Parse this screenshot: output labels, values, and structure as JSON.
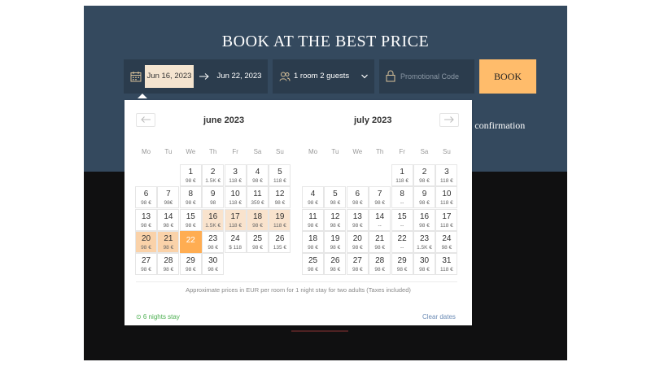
{
  "header": {
    "title": "BOOK AT THE BEST PRICE",
    "confirmation_fragment": "e confirmation"
  },
  "search": {
    "check_in": "Jun 16, 2023",
    "check_out": "Jun 22, 2023",
    "guests": "1 room 2 guests",
    "promo_placeholder": "Promotional Code",
    "book_label": "BOOK"
  },
  "colors": {
    "hero_bg": "#34495e",
    "field_bg": "#2b3c4d",
    "book_button": "#ffbc6b",
    "selected_end": "#ffad52",
    "range_bg": "#f9e3cd",
    "stay_text": "#4caf50",
    "link": "#6b8bb5"
  },
  "icons": [
    "calendar-icon",
    "arrow-right-icon",
    "people-icon",
    "chevron-down-icon",
    "lock-icon",
    "arrow-left-icon"
  ],
  "calendar": {
    "weekdays": [
      "Mo",
      "Tu",
      "We",
      "Th",
      "Fr",
      "Sa",
      "Su"
    ],
    "months": [
      {
        "name": "june 2023",
        "first_weekday": 3,
        "days": [
          {
            "d": "1",
            "p": "98 €"
          },
          {
            "d": "2",
            "p": "1.5K €"
          },
          {
            "d": "3",
            "p": "118 €"
          },
          {
            "d": "4",
            "p": "98 €"
          },
          {
            "d": "5",
            "p": "118 €"
          },
          {
            "d": "6",
            "p": "98 €"
          },
          {
            "d": "7",
            "p": "98€"
          },
          {
            "d": "8",
            "p": "98 €"
          },
          {
            "d": "9",
            "p": "98"
          },
          {
            "d": "10",
            "p": "118 €"
          },
          {
            "d": "11",
            "p": "359 €"
          },
          {
            "d": "12",
            "p": "98 €"
          },
          {
            "d": "13",
            "p": "98 €"
          },
          {
            "d": "14",
            "p": "98 €"
          },
          {
            "d": "15",
            "p": "98 €"
          },
          {
            "d": "16",
            "p": "1.5K €",
            "state": "range"
          },
          {
            "d": "17",
            "p": "118 €",
            "state": "range"
          },
          {
            "d": "18",
            "p": "98 €",
            "state": "range"
          },
          {
            "d": "19",
            "p": "118 €",
            "state": "range"
          },
          {
            "d": "20",
            "p": "98 €",
            "state": "sel"
          },
          {
            "d": "21",
            "p": "98 €",
            "state": "sel"
          },
          {
            "d": "22",
            "p": "",
            "state": "end"
          },
          {
            "d": "23",
            "p": "98 €"
          },
          {
            "d": "24",
            "p": "$ 118"
          },
          {
            "d": "25",
            "p": "98 €"
          },
          {
            "d": "26",
            "p": "135 €"
          },
          {
            "d": "27",
            "p": "98 €"
          },
          {
            "d": "28",
            "p": "98 €"
          },
          {
            "d": "29",
            "p": "98 €"
          },
          {
            "d": "30",
            "p": "98 €"
          }
        ]
      },
      {
        "name": "july 2023",
        "first_weekday": 5,
        "days": [
          {
            "d": "1",
            "p": "118 €"
          },
          {
            "d": "2",
            "p": "98 €"
          },
          {
            "d": "3",
            "p": "118 €"
          },
          {
            "d": "4",
            "p": "98 €"
          },
          {
            "d": "5",
            "p": "98 €"
          },
          {
            "d": "6",
            "p": "98 €"
          },
          {
            "d": "7",
            "p": "98 €"
          },
          {
            "d": "8",
            "p": "--"
          },
          {
            "d": "9",
            "p": "98 €"
          },
          {
            "d": "10",
            "p": "118 €"
          },
          {
            "d": "11",
            "p": "98 €"
          },
          {
            "d": "12",
            "p": "98 €"
          },
          {
            "d": "13",
            "p": "98 €"
          },
          {
            "d": "14",
            "p": "--"
          },
          {
            "d": "15",
            "p": "--"
          },
          {
            "d": "16",
            "p": "98 €"
          },
          {
            "d": "17",
            "p": "118 €"
          },
          {
            "d": "18",
            "p": "98 €"
          },
          {
            "d": "19",
            "p": "98 €"
          },
          {
            "d": "20",
            "p": "98 €"
          },
          {
            "d": "21",
            "p": "98 €"
          },
          {
            "d": "22",
            "p": "--"
          },
          {
            "d": "23",
            "p": "1.5K €"
          },
          {
            "d": "24",
            "p": "98 €"
          },
          {
            "d": "25",
            "p": "98 €"
          },
          {
            "d": "26",
            "p": "98 €"
          },
          {
            "d": "27",
            "p": "98 €"
          },
          {
            "d": "28",
            "p": "98 €"
          },
          {
            "d": "29",
            "p": "98 €"
          },
          {
            "d": "30",
            "p": "98 €"
          },
          {
            "d": "31",
            "p": "118 €"
          }
        ]
      }
    ],
    "note": "Approximate prices in EUR per room for 1 night stay for two adults  (Taxes included)",
    "stay_summary": "⊙ 6 nights stay",
    "clear_label": "Clear dates"
  }
}
